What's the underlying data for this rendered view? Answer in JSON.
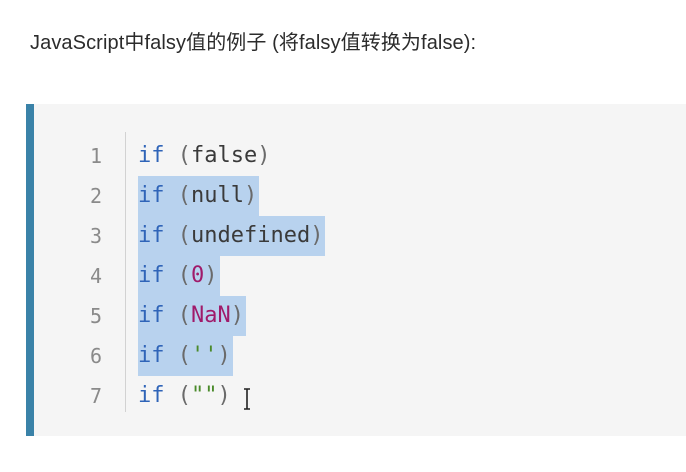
{
  "heading": "JavaScript中falsy值的例子 (将falsy值转换为false):",
  "code": {
    "lines": [
      {
        "num": "1",
        "kw": "if",
        "open": " (",
        "value": "false",
        "close": ")"
      },
      {
        "num": "2",
        "kw": "if",
        "open": " (",
        "value": "null",
        "close": ")"
      },
      {
        "num": "3",
        "kw": "if",
        "open": " (",
        "value": "undefined",
        "close": ")"
      },
      {
        "num": "4",
        "kw": "if",
        "open": " (",
        "value": "0",
        "close": ")"
      },
      {
        "num": "5",
        "kw": "if",
        "open": " (",
        "value": "NaN",
        "close": ")"
      },
      {
        "num": "6",
        "kw": "if",
        "open": " (",
        "value": "''",
        "close": ")"
      },
      {
        "num": "7",
        "kw": "if",
        "open": " (",
        "value": "\"\"",
        "close": ")"
      }
    ]
  },
  "colors": {
    "accent_bar": "#3a82a8",
    "keyword": "#2f64b8",
    "number_literal": "#a01a6a",
    "string_literal": "#4a8a2a",
    "selection": "#b8d2ee"
  }
}
